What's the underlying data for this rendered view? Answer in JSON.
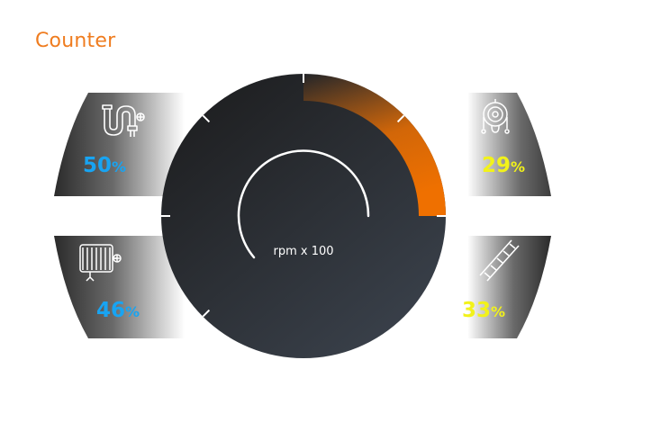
{
  "header": {
    "title": "Counter"
  },
  "gauge": {
    "label": "rpm x 100",
    "colors": {
      "dial_top": "#1f2022",
      "dial_bottom": "#3a414b",
      "accent": "#ef7000",
      "needle": "#ffffff"
    }
  },
  "panels": [
    {
      "id": "pipe",
      "icon": "pipe-fitting-icon",
      "value": "50",
      "unit": "%",
      "color": "#18a4f2"
    },
    {
      "id": "radiator",
      "icon": "radiator-icon",
      "value": "46",
      "unit": "%",
      "color": "#18a4f2"
    },
    {
      "id": "pulley",
      "icon": "pulley-chain-icon",
      "value": "29",
      "unit": "%",
      "color": "#f2f21a"
    },
    {
      "id": "ladder",
      "icon": "ladder-icon",
      "value": "33",
      "unit": "%",
      "color": "#f2f21a"
    }
  ]
}
